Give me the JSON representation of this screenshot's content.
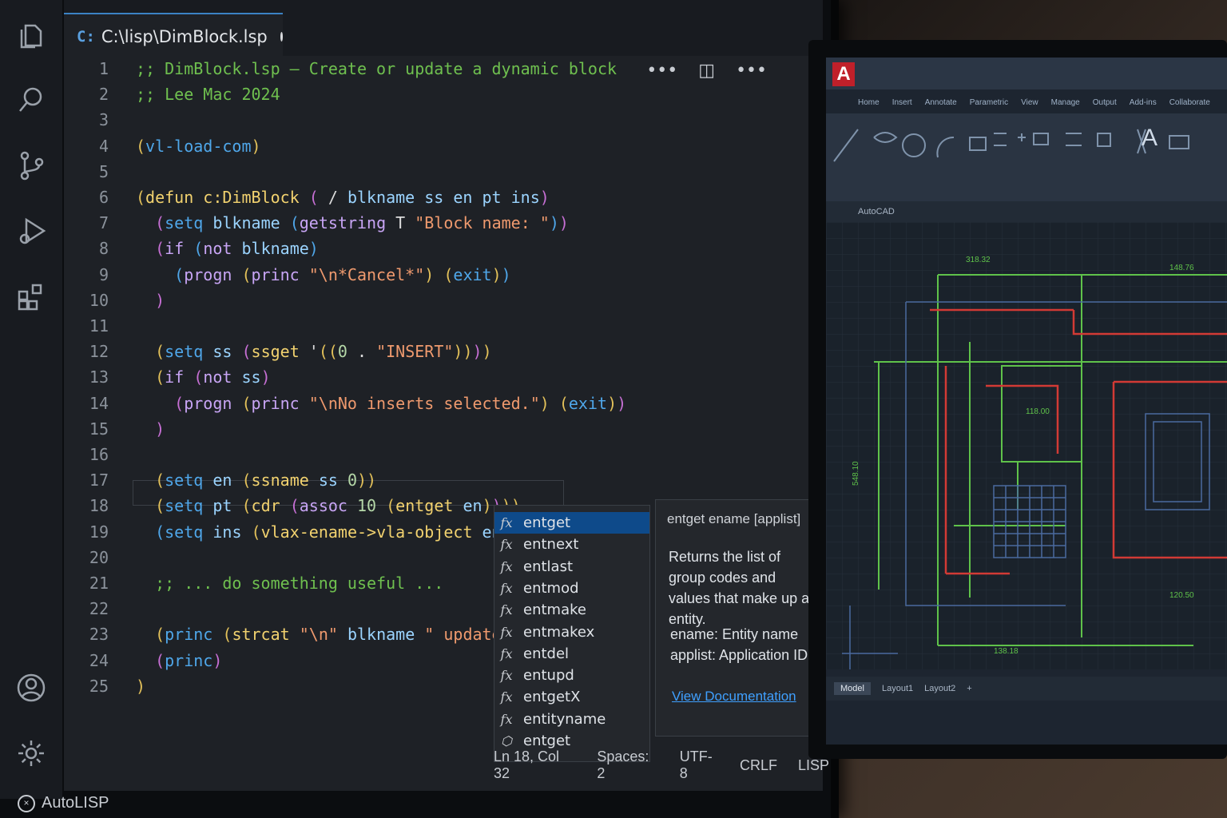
{
  "editor": {
    "tab": {
      "lang_badge": "C:",
      "title": "C:\\lisp\\DimBlock.lsp"
    },
    "toolbar": {
      "more_label": "•••",
      "split_label": "◫",
      "more2_label": "•••"
    },
    "lines": [
      {
        "n": "1",
        "tokens": [
          [
            "c-com",
            ";; DimBlock.lsp – Create or update a dynamic block"
          ]
        ]
      },
      {
        "n": "2",
        "tokens": [
          [
            "c-com",
            ";; Lee Mac 2024"
          ]
        ]
      },
      {
        "n": "3",
        "tokens": []
      },
      {
        "n": "4",
        "tokens": [
          [
            "c-p1",
            "("
          ],
          [
            "c-p3",
            "vl-load-com"
          ],
          [
            "c-p1",
            ")"
          ]
        ]
      },
      {
        "n": "5",
        "tokens": []
      },
      {
        "n": "6",
        "tokens": [
          [
            "c-p1",
            "("
          ],
          [
            "c-fn",
            "defun "
          ],
          [
            "c-fn",
            "c:DimBlock"
          ],
          [
            "c-sym",
            " "
          ],
          [
            "c-p2",
            "("
          ],
          [
            "c-sym",
            " / "
          ],
          [
            "c-var",
            "blkname ss en pt ins"
          ],
          [
            "c-p2",
            ")"
          ]
        ]
      },
      {
        "n": "7",
        "tokens": [
          [
            "c-sym",
            "  "
          ],
          [
            "c-p2",
            "("
          ],
          [
            "c-p3",
            "setq "
          ],
          [
            "c-var",
            "blkname "
          ],
          [
            "c-p3",
            "("
          ],
          [
            "c-kw",
            "getstring "
          ],
          [
            "c-sym",
            "T "
          ],
          [
            "c-str",
            "\"Block name: \""
          ],
          [
            "c-p3",
            ")"
          ],
          [
            "c-p2",
            ")"
          ]
        ]
      },
      {
        "n": "8",
        "tokens": [
          [
            "c-sym",
            "  "
          ],
          [
            "c-p2",
            "("
          ],
          [
            "c-kw",
            "if "
          ],
          [
            "c-p3",
            "("
          ],
          [
            "c-kw",
            "not "
          ],
          [
            "c-var",
            "blkname"
          ],
          [
            "c-p3",
            ")"
          ]
        ]
      },
      {
        "n": "9",
        "tokens": [
          [
            "c-sym",
            "    "
          ],
          [
            "c-p3",
            "("
          ],
          [
            "c-kw",
            "progn "
          ],
          [
            "c-p1",
            "("
          ],
          [
            "c-kw",
            "princ "
          ],
          [
            "c-str",
            "\"\\n*Cancel*\""
          ],
          [
            "c-p1",
            ")"
          ],
          [
            "c-sym",
            " "
          ],
          [
            "c-p1",
            "("
          ],
          [
            "c-p3",
            "exit"
          ],
          [
            "c-p1",
            ")"
          ],
          [
            "c-p3",
            ")"
          ]
        ]
      },
      {
        "n": "10",
        "tokens": [
          [
            "c-sym",
            "  "
          ],
          [
            "c-p2",
            ")"
          ]
        ]
      },
      {
        "n": "11",
        "tokens": []
      },
      {
        "n": "12",
        "tokens": [
          [
            "c-sym",
            "  "
          ],
          [
            "c-p1",
            "("
          ],
          [
            "c-p3",
            "setq "
          ],
          [
            "c-var",
            "ss "
          ],
          [
            "c-p2",
            "("
          ],
          [
            "c-fn",
            "ssget "
          ],
          [
            "c-sym",
            "'"
          ],
          [
            "c-p1",
            "(("
          ],
          [
            "c-num",
            "0"
          ],
          [
            "c-sym",
            " . "
          ],
          [
            "c-str",
            "\"INSERT\""
          ],
          [
            "c-p1",
            "))"
          ],
          [
            "c-p2",
            ")"
          ],
          [
            "c-p1",
            ")"
          ]
        ]
      },
      {
        "n": "13",
        "tokens": [
          [
            "c-sym",
            "  "
          ],
          [
            "c-p1",
            "("
          ],
          [
            "c-kw",
            "if "
          ],
          [
            "c-p2",
            "("
          ],
          [
            "c-kw",
            "not "
          ],
          [
            "c-var",
            "ss"
          ],
          [
            "c-p2",
            ")"
          ]
        ]
      },
      {
        "n": "14",
        "tokens": [
          [
            "c-sym",
            "    "
          ],
          [
            "c-p2",
            "("
          ],
          [
            "c-kw",
            "progn "
          ],
          [
            "c-p1",
            "("
          ],
          [
            "c-kw",
            "princ "
          ],
          [
            "c-str",
            "\"\\nNo inserts selected.\""
          ],
          [
            "c-p1",
            ")"
          ],
          [
            "c-sym",
            " "
          ],
          [
            "c-p1",
            "("
          ],
          [
            "c-p3",
            "exit"
          ],
          [
            "c-p1",
            ")"
          ],
          [
            "c-p2",
            ")"
          ]
        ]
      },
      {
        "n": "15",
        "tokens": [
          [
            "c-sym",
            "  "
          ],
          [
            "c-p2",
            ")"
          ]
        ]
      },
      {
        "n": "16",
        "tokens": []
      },
      {
        "n": "17",
        "tokens": [
          [
            "c-sym",
            "  "
          ],
          [
            "c-p1",
            "("
          ],
          [
            "c-p3",
            "setq "
          ],
          [
            "c-var",
            "en "
          ],
          [
            "c-p1",
            "("
          ],
          [
            "c-fn",
            "ssname "
          ],
          [
            "c-var",
            "ss "
          ],
          [
            "c-num",
            "0"
          ],
          [
            "c-p1",
            "))"
          ]
        ]
      },
      {
        "n": "18",
        "tokens": [
          [
            "c-sym",
            "  "
          ],
          [
            "c-p1",
            "("
          ],
          [
            "c-p3",
            "setq "
          ],
          [
            "c-var",
            "pt "
          ],
          [
            "c-p1",
            "("
          ],
          [
            "c-fn",
            "cdr "
          ],
          [
            "c-p2",
            "("
          ],
          [
            "c-kw",
            "assoc "
          ],
          [
            "c-num",
            "10 "
          ],
          [
            "c-p1",
            "("
          ],
          [
            "c-fn",
            "entget "
          ],
          [
            "c-var",
            "en"
          ],
          [
            "c-p1",
            ")"
          ],
          [
            "c-p2",
            ")"
          ],
          [
            "c-p1",
            ")"
          ],
          [
            "c-p1",
            ")"
          ]
        ]
      },
      {
        "n": "19",
        "tokens": [
          [
            "c-sym",
            "  "
          ],
          [
            "c-p3",
            "("
          ],
          [
            "c-p3",
            "setq "
          ],
          [
            "c-var",
            "ins "
          ],
          [
            "c-p1",
            "("
          ],
          [
            "c-fn",
            "vlax-ename->vla-object "
          ],
          [
            "c-var",
            "en"
          ],
          [
            "c-p1",
            ")"
          ],
          [
            "c-p3",
            ")"
          ]
        ]
      },
      {
        "n": "20",
        "tokens": []
      },
      {
        "n": "21",
        "tokens": [
          [
            "c-sym",
            "  "
          ],
          [
            "c-com",
            ";; ... do something useful ..."
          ]
        ]
      },
      {
        "n": "22",
        "tokens": []
      },
      {
        "n": "23",
        "tokens": [
          [
            "c-sym",
            "  "
          ],
          [
            "c-p1",
            "("
          ],
          [
            "c-p3",
            "princ "
          ],
          [
            "c-p1",
            "("
          ],
          [
            "c-fn",
            "strcat "
          ],
          [
            "c-str",
            "\"\\n\""
          ],
          [
            "c-sym",
            " "
          ],
          [
            "c-var",
            "blkname "
          ],
          [
            "c-str",
            "\" updated.\""
          ],
          [
            "c-p1",
            "))"
          ]
        ]
      },
      {
        "n": "24",
        "tokens": [
          [
            "c-sym",
            "  "
          ],
          [
            "c-p2",
            "("
          ],
          [
            "c-p3",
            "princ"
          ],
          [
            "c-p2",
            ")"
          ]
        ]
      },
      {
        "n": "25",
        "tokens": [
          [
            "c-p1",
            ")"
          ]
        ]
      }
    ]
  },
  "suggest": {
    "items": [
      {
        "icon": "function-icon",
        "glyph": "fx",
        "label": "entget",
        "active": true
      },
      {
        "icon": "function-icon",
        "glyph": "fx",
        "label": "entnext"
      },
      {
        "icon": "function-icon",
        "glyph": "fx",
        "label": "entlast"
      },
      {
        "icon": "function-icon",
        "glyph": "fx",
        "label": "entmod"
      },
      {
        "icon": "function-icon",
        "glyph": "fx",
        "label": "entmake"
      },
      {
        "icon": "function-icon",
        "glyph": "fx",
        "label": "entmakex"
      },
      {
        "icon": "function-icon",
        "glyph": "fx",
        "label": "entdel"
      },
      {
        "icon": "function-icon",
        "glyph": "fx",
        "label": "entupd"
      },
      {
        "icon": "function-icon",
        "glyph": "fx",
        "label": "entgetX"
      },
      {
        "icon": "function-icon",
        "glyph": "fx",
        "label": "entityname"
      },
      {
        "icon": "cube-icon",
        "glyph": "⬡",
        "label": "entget"
      }
    ],
    "doc": {
      "signature": "entget ename [applist]",
      "description": "Returns the list of group codes and values that make up an entity.",
      "param1": "ename: Entity name",
      "param2": "applist: Application ID list",
      "link": "View Documentation"
    }
  },
  "status": {
    "position": "Ln 18, Col 32",
    "spaces": "Spaces: 2",
    "encoding": "UTF-8",
    "eol": "CRLF",
    "language": "LISP"
  },
  "bottom_label": "AutoLISP",
  "cad": {
    "logo": "A",
    "ribbon_tabs": [
      "Home",
      "Insert",
      "Annotate",
      "Parametric",
      "View",
      "Manage",
      "Output",
      "Add-ins",
      "Collaborate"
    ],
    "doc_tab": "AutoCAD",
    "layouts": [
      "Model",
      "Layout1",
      "Layout2"
    ],
    "dims": [
      "318.32",
      "148.76",
      "548.10",
      "118.00",
      "120.50",
      "138.18"
    ]
  }
}
